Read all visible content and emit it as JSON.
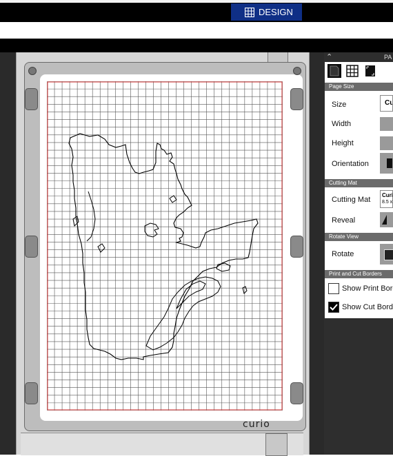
{
  "header": {
    "design_tab_label": "DESIGN"
  },
  "panel": {
    "title_partial": "PA",
    "page_size_section": "Page Size",
    "size_label": "Size",
    "size_value_partial": "Cu",
    "width_label": "Width",
    "height_label": "Height",
    "orientation_label": "Orientation",
    "cutting_mat_section": "Cutting Mat",
    "cutting_mat_label": "Cutting Mat",
    "cutting_mat_value_line1": "Curi",
    "cutting_mat_value_line2": "8.5 x",
    "reveal_label": "Reveal",
    "rotate_view_section": "Rotate View",
    "rotate_label": "Rotate",
    "borders_section": "Print and Cut Borders",
    "show_print_border_label": "Show Print Borde",
    "show_print_border_checked": false,
    "show_cut_border_label": "Show Cut Border",
    "show_cut_border_checked": true
  },
  "mat": {
    "brand_label": "curio"
  },
  "colors": {
    "design_tab_bg": "#0f2f86",
    "grid_line": "#555555",
    "cut_border": "#d33333",
    "section_header": "#6b6b6b"
  }
}
